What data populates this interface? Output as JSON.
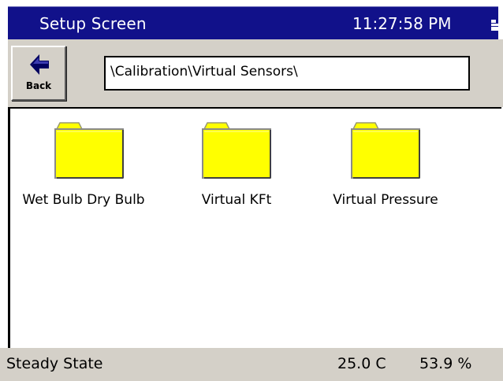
{
  "titlebar": {
    "title": "Setup Screen",
    "clock": "11:27:58 PM",
    "status_icon": "signal-icon"
  },
  "toolbar": {
    "back_label": "Back",
    "back_icon": "left-arrow-icon",
    "path": "\\Calibration\\Virtual Sensors\\"
  },
  "folders": [
    {
      "name": "Wet Bulb Dry Bulb",
      "icon": "folder-icon"
    },
    {
      "name": "Virtual KFt",
      "icon": "folder-icon"
    },
    {
      "name": "Virtual Pressure",
      "icon": "folder-icon"
    }
  ],
  "statusbar": {
    "state": "Steady State",
    "temperature": "25.0 C",
    "humidity": "53.9 %"
  },
  "colors": {
    "titlebar_bg": "#11118a",
    "toolbar_bg": "#d4d0c8",
    "folder_yellow": "#ffff00",
    "arrow_blue": "#000060"
  }
}
